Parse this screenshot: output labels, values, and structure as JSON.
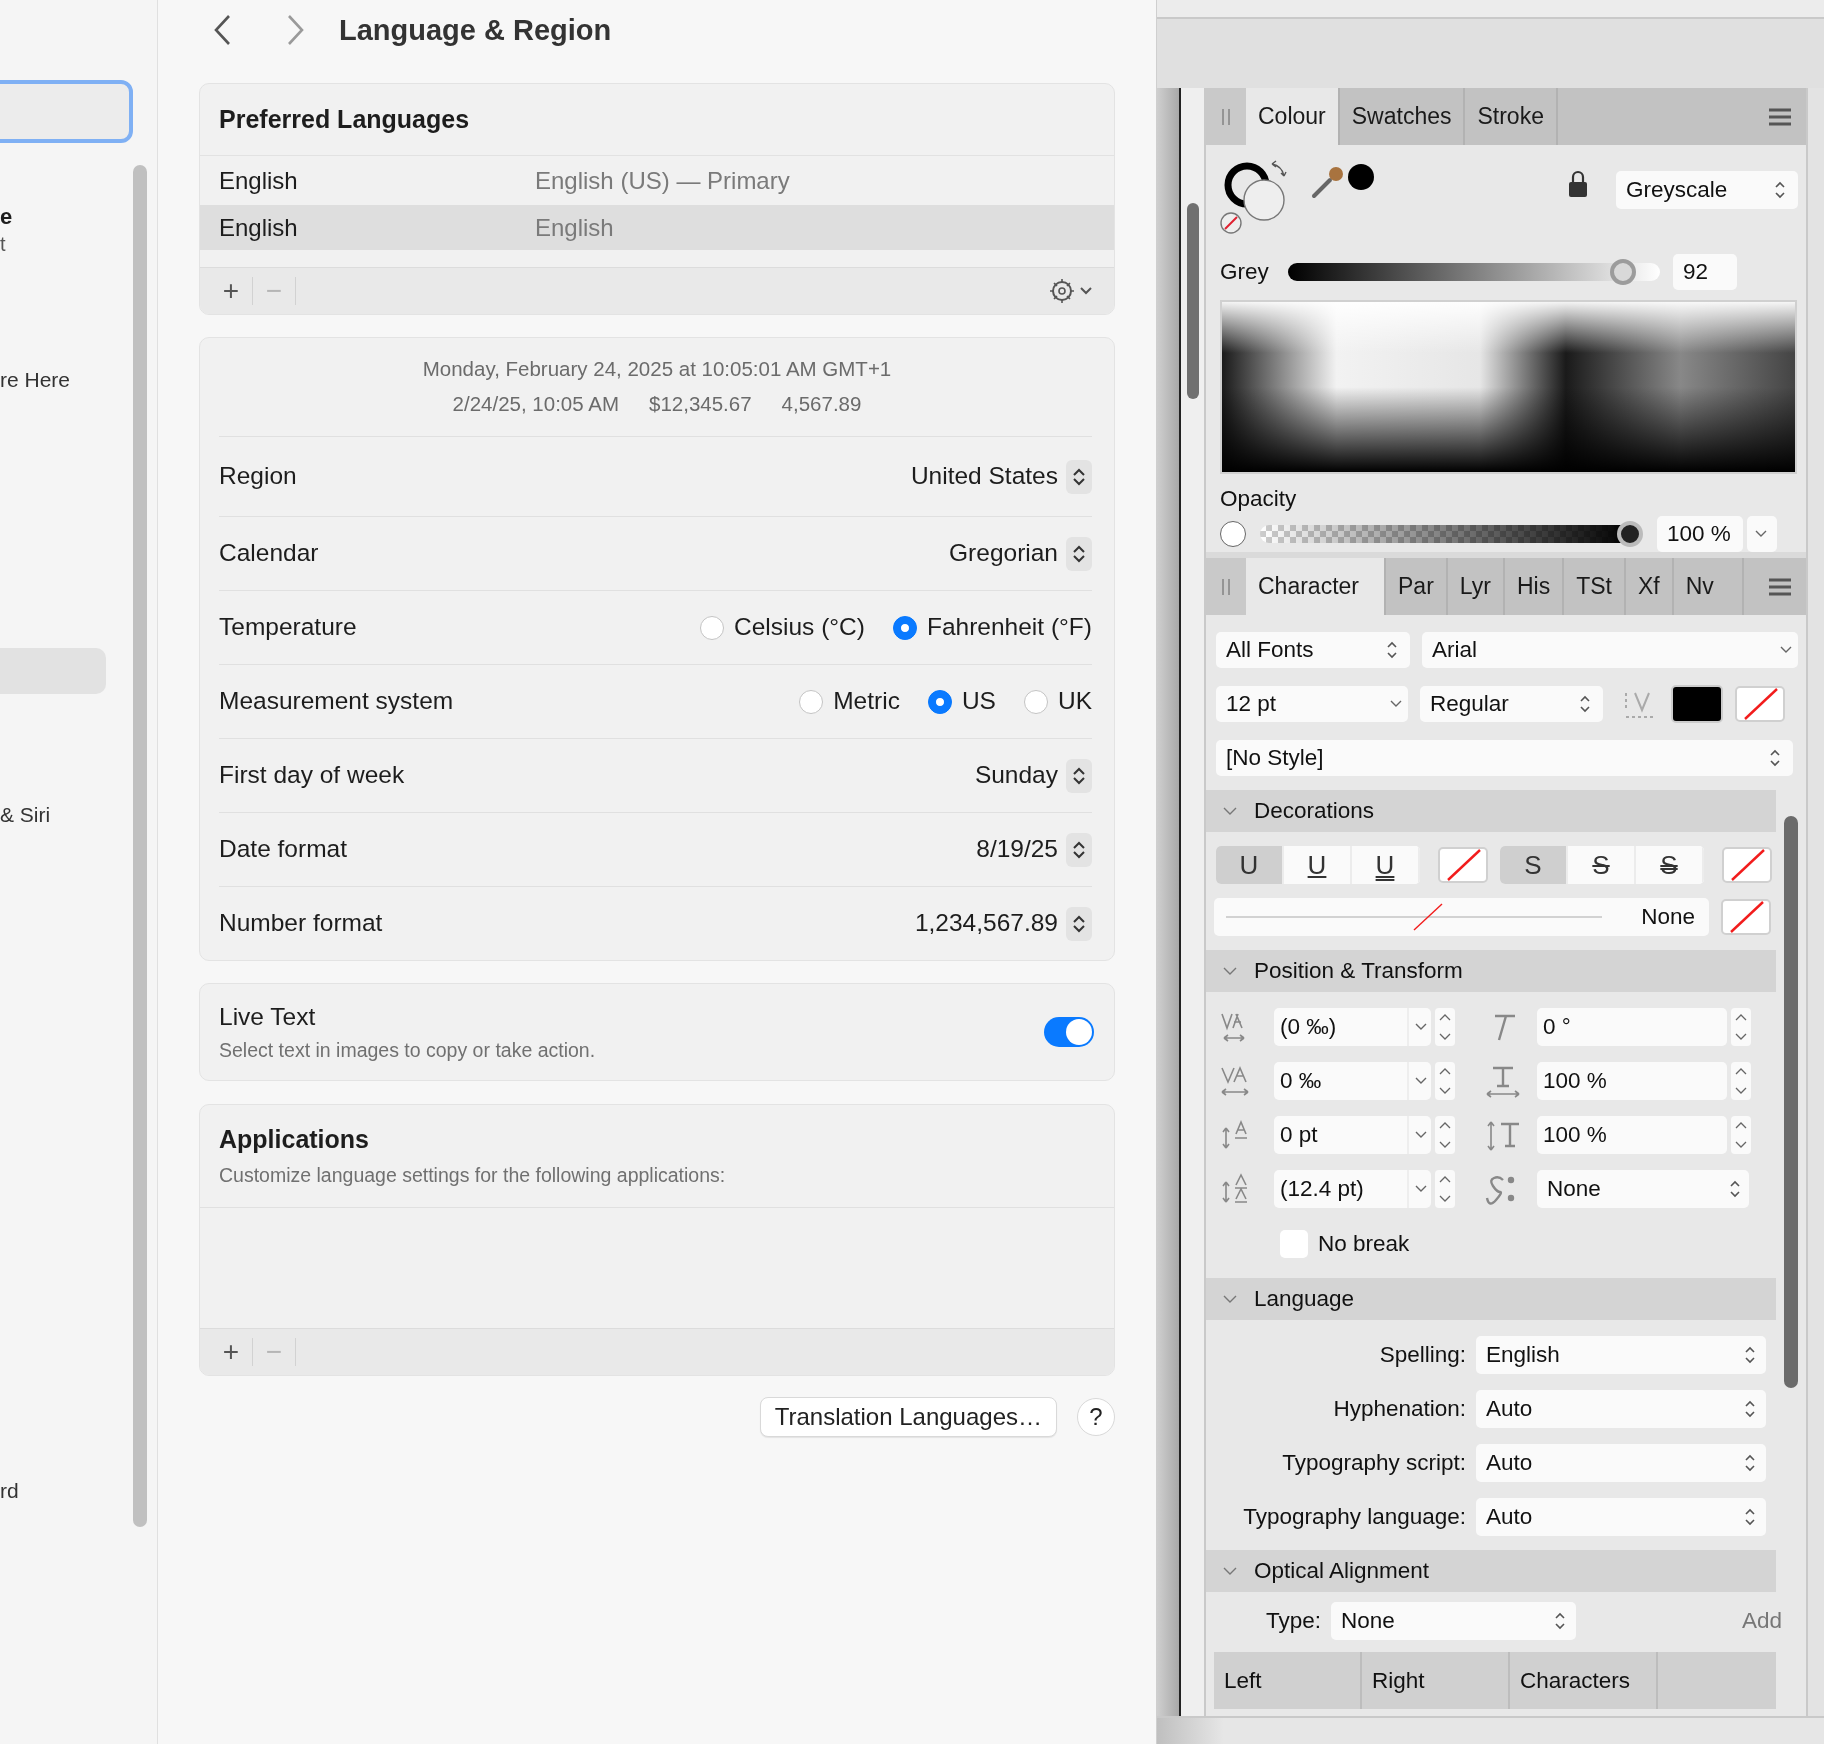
{
  "sidebar": {
    "account": {
      "name": "e",
      "subtitle": "t"
    },
    "items": [
      {
        "label": "re Here",
        "selected": false
      },
      {
        "selected": true
      },
      {
        "label": "& Siri",
        "selected": false
      },
      {
        "label": "rd",
        "selected": false
      }
    ]
  },
  "header": {
    "title": "Language & Region"
  },
  "preferred_languages": {
    "title": "Preferred Languages",
    "rows": [
      {
        "language": "English",
        "detail": "English (US) — Primary",
        "selected": false
      },
      {
        "language": "English",
        "detail": "English",
        "selected": true
      }
    ],
    "add": "+",
    "remove": "−"
  },
  "format_preview": {
    "line": "Monday, February 24, 2025 at 10:05:01 AM GMT+1",
    "samples": [
      "2/24/25, 10:05 AM",
      "$12,345.67",
      "4,567.89"
    ]
  },
  "settings": [
    {
      "kind": "popup",
      "label": "Region",
      "value": "United States"
    },
    {
      "kind": "popup",
      "label": "Calendar",
      "value": "Gregorian"
    },
    {
      "kind": "radio",
      "label": "Temperature",
      "options": [
        {
          "label": "Celsius (°C)",
          "selected": false
        },
        {
          "label": "Fahrenheit (°F)",
          "selected": true
        }
      ]
    },
    {
      "kind": "radio",
      "label": "Measurement system",
      "options": [
        {
          "label": "Metric",
          "selected": false
        },
        {
          "label": "US",
          "selected": true
        },
        {
          "label": "UK",
          "selected": false
        }
      ]
    },
    {
      "kind": "popup",
      "label": "First day of week",
      "value": "Sunday"
    },
    {
      "kind": "popup",
      "label": "Date format",
      "value": "8/19/25"
    },
    {
      "kind": "popup",
      "label": "Number format",
      "value": "1,234,567.89"
    }
  ],
  "live_text": {
    "title": "Live Text",
    "description": "Select text in images to copy or take action.",
    "on": true
  },
  "applications": {
    "title": "Applications",
    "description": "Customize language settings for the following applications:",
    "add": "+",
    "remove": "−"
  },
  "buttons": [
    {
      "kind": "text",
      "label": "Translation Languages…"
    },
    {
      "kind": "help",
      "label": "?"
    }
  ],
  "colour_panel": {
    "tabs": [
      {
        "label": "Colour",
        "selected": true
      },
      {
        "label": "Swatches",
        "selected": false
      },
      {
        "label": "Stroke",
        "selected": false
      }
    ],
    "model": "Greyscale",
    "grey": {
      "label": "Grey",
      "level": 0.9,
      "value": "92"
    },
    "opacity": {
      "label": "Opacity",
      "level": 1,
      "value": "100 %"
    }
  },
  "character_panel": {
    "tabs": [
      {
        "label": "Character",
        "selected": true
      },
      {
        "label": "Par",
        "selected": false
      },
      {
        "label": "Lyr",
        "selected": false
      },
      {
        "label": "His",
        "selected": false
      },
      {
        "label": "TSt",
        "selected": false
      },
      {
        "label": "Xf",
        "selected": false
      },
      {
        "label": "Nv",
        "selected": false
      }
    ],
    "font_collection": "All Fonts",
    "font": "Arial",
    "size": "12 pt",
    "weight": "Regular",
    "style": "[No Style]",
    "sections": [
      {
        "kind": "decorations",
        "title": "Decorations",
        "expanded": true,
        "underline": [
          {
            "label": "U",
            "kind": "none",
            "selected": true
          },
          {
            "label": "U",
            "kind": "single",
            "selected": false
          },
          {
            "label": "U",
            "kind": "double",
            "selected": false
          }
        ],
        "strikethrough": [
          {
            "label": "S",
            "kind": "none",
            "selected": true
          },
          {
            "label": "S",
            "kind": "single",
            "selected": false
          },
          {
            "label": "S",
            "kind": "double",
            "selected": false
          }
        ],
        "line_style": "None"
      },
      {
        "kind": "position",
        "title": "Position & Transform",
        "expanded": true,
        "fields": [
          {
            "kind": "tracking",
            "value": "(0 ‰)"
          },
          {
            "kind": "shear",
            "value": "0 °"
          },
          {
            "kind": "kerning",
            "value": "0 ‰"
          },
          {
            "kind": "horizontal_scale",
            "value": "100 %"
          },
          {
            "kind": "baseline",
            "value": "0 pt"
          },
          {
            "kind": "vertical_scale",
            "value": "100 %"
          },
          {
            "kind": "leading",
            "value": "(12.4 pt)"
          },
          {
            "kind": "script",
            "value": "None"
          }
        ],
        "no_break": {
          "label": "No break",
          "checked": false
        }
      },
      {
        "kind": "language",
        "title": "Language",
        "expanded": true,
        "rows": [
          {
            "label": "Spelling:",
            "value": "English"
          },
          {
            "label": "Hyphenation:",
            "value": "Auto"
          },
          {
            "label": "Typography script:",
            "value": "Auto"
          },
          {
            "label": "Typography language:",
            "value": "Auto"
          }
        ]
      },
      {
        "kind": "optical",
        "title": "Optical Alignment",
        "expanded": true,
        "type_label": "Type:",
        "type_value": "None",
        "add": "Add",
        "columns": [
          "Left",
          "Right",
          "Characters"
        ]
      }
    ]
  }
}
